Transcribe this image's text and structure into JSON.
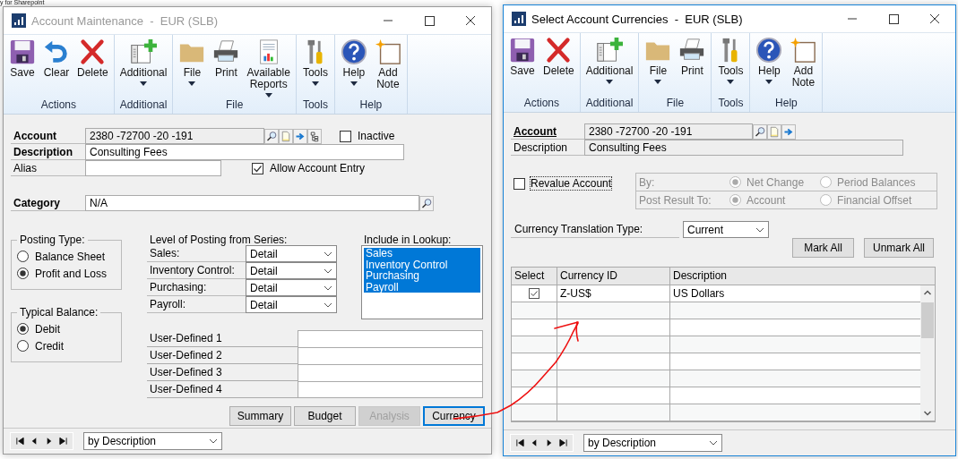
{
  "background": {
    "text": "y for Sharepoint"
  },
  "account_maintenance": {
    "window": {
      "title": "Account Maintenance  -  EUR (SLB)",
      "active": false
    },
    "ribbon": [
      {
        "label": "Actions",
        "buttons": [
          {
            "label": "Save",
            "kind": "save",
            "dropdown": false
          },
          {
            "label": "Clear",
            "kind": "clear",
            "dropdown": false
          },
          {
            "label": "Delete",
            "kind": "delete",
            "dropdown": false
          }
        ]
      },
      {
        "label": "Additional",
        "buttons": [
          {
            "label": "Additional",
            "kind": "additional",
            "dropdown": true
          }
        ]
      },
      {
        "label": "File",
        "buttons": [
          {
            "label": "File",
            "kind": "file",
            "dropdown": true
          },
          {
            "label": "Print",
            "kind": "print",
            "dropdown": false
          },
          {
            "label": "Available Reports",
            "kind": "reports",
            "dropdown": true
          }
        ]
      },
      {
        "label": "Tools",
        "buttons": [
          {
            "label": "Tools",
            "kind": "tools",
            "dropdown": true
          }
        ]
      },
      {
        "label": "Help",
        "buttons": [
          {
            "label": "Help",
            "kind": "help",
            "dropdown": true
          },
          {
            "label": "Add Note",
            "kind": "note",
            "dropdown": false
          }
        ]
      }
    ],
    "fields": {
      "account": {
        "label": "Account",
        "value": "2380 -72700 -20 -191"
      },
      "inactive": {
        "label": "Inactive",
        "checked": false
      },
      "description": {
        "label": "Description",
        "value": "Consulting Fees"
      },
      "alias": {
        "label": "Alias"
      },
      "allow_account_entry": {
        "label": "Allow Account Entry",
        "checked": true
      },
      "category": {
        "label": "Category",
        "value": "N/A"
      }
    },
    "posting_type": {
      "label": "Posting Type:",
      "options": [
        {
          "label": "Balance Sheet",
          "selected": false
        },
        {
          "label": "Profit and Loss",
          "selected": true
        }
      ]
    },
    "typical_balance": {
      "label": "Typical Balance:",
      "options": [
        {
          "label": "Debit",
          "selected": true
        },
        {
          "label": "Credit",
          "selected": false
        }
      ]
    },
    "level_of_posting": {
      "label": "Level of Posting from Series:",
      "rows": [
        {
          "label": "Sales:",
          "value": "Detail"
        },
        {
          "label": "Inventory Control:",
          "value": "Detail"
        },
        {
          "label": "Purchasing:",
          "value": "Detail"
        },
        {
          "label": "Payroll:",
          "value": "Detail"
        }
      ]
    },
    "include_in_lookup": {
      "label": "Include in Lookup:",
      "items": [
        {
          "label": "Sales",
          "selected": true
        },
        {
          "label": "Inventory Control",
          "selected": true
        },
        {
          "label": "Purchasing",
          "selected": true
        },
        {
          "label": "Payroll",
          "selected": true
        }
      ]
    },
    "user_defined": [
      {
        "label": "User-Defined 1"
      },
      {
        "label": "User-Defined 2"
      },
      {
        "label": "User-Defined 3"
      },
      {
        "label": "User-Defined 4"
      }
    ],
    "buttons": [
      {
        "label": "Summary",
        "disabled": false,
        "focused": false
      },
      {
        "label": "Budget",
        "disabled": false,
        "focused": false
      },
      {
        "label": "Analysis",
        "disabled": true,
        "focused": false
      },
      {
        "label": "Currency",
        "disabled": false,
        "focused": true
      }
    ],
    "sort_by": "by Description"
  },
  "select_account_currencies": {
    "window": {
      "title": "Select Account Currencies  -  EUR (SLB)",
      "active": true
    },
    "ribbon": [
      {
        "label": "Actions",
        "buttons": [
          {
            "label": "Save",
            "kind": "save",
            "dropdown": false
          },
          {
            "label": "Delete",
            "kind": "delete",
            "dropdown": false
          }
        ]
      },
      {
        "label": "Additional",
        "buttons": [
          {
            "label": "Additional",
            "kind": "additional",
            "dropdown": true
          }
        ]
      },
      {
        "label": "File",
        "buttons": [
          {
            "label": "File",
            "kind": "file",
            "dropdown": true
          },
          {
            "label": "Print",
            "kind": "print",
            "dropdown": false
          }
        ]
      },
      {
        "label": "Tools",
        "buttons": [
          {
            "label": "Tools",
            "kind": "tools",
            "dropdown": true
          }
        ]
      },
      {
        "label": "Help",
        "buttons": [
          {
            "label": "Help",
            "kind": "help",
            "dropdown": true
          },
          {
            "label": "Add Note",
            "kind": "note",
            "dropdown": false
          }
        ]
      }
    ],
    "account": {
      "label": "Account",
      "value": "2380 -72700 -20 -191"
    },
    "description": {
      "label": "Description",
      "value": "Consulting Fees"
    },
    "revalue_account": {
      "label": "Revalue Account",
      "checked": false
    },
    "revaluation": {
      "disabled": true,
      "rows": [
        {
          "label": "By:",
          "options": [
            {
              "label": "Net Change",
              "selected": true
            },
            {
              "label": "Period Balances",
              "selected": false
            }
          ]
        },
        {
          "label": "Post Result To:",
          "options": [
            {
              "label": "Account",
              "selected": true
            },
            {
              "label": "Financial Offset",
              "selected": false
            }
          ]
        }
      ]
    },
    "currency_translation_type": {
      "label": "Currency Translation Type:",
      "value": "Current"
    },
    "buttons": [
      "Mark All",
      "Unmark All"
    ],
    "grid": {
      "columns": [
        "Select",
        "Currency ID",
        "Description"
      ],
      "rows": [
        {
          "checked": true,
          "currency_id": "Z-US$",
          "description": "US Dollars"
        }
      ]
    },
    "sort_by": "by Description"
  }
}
